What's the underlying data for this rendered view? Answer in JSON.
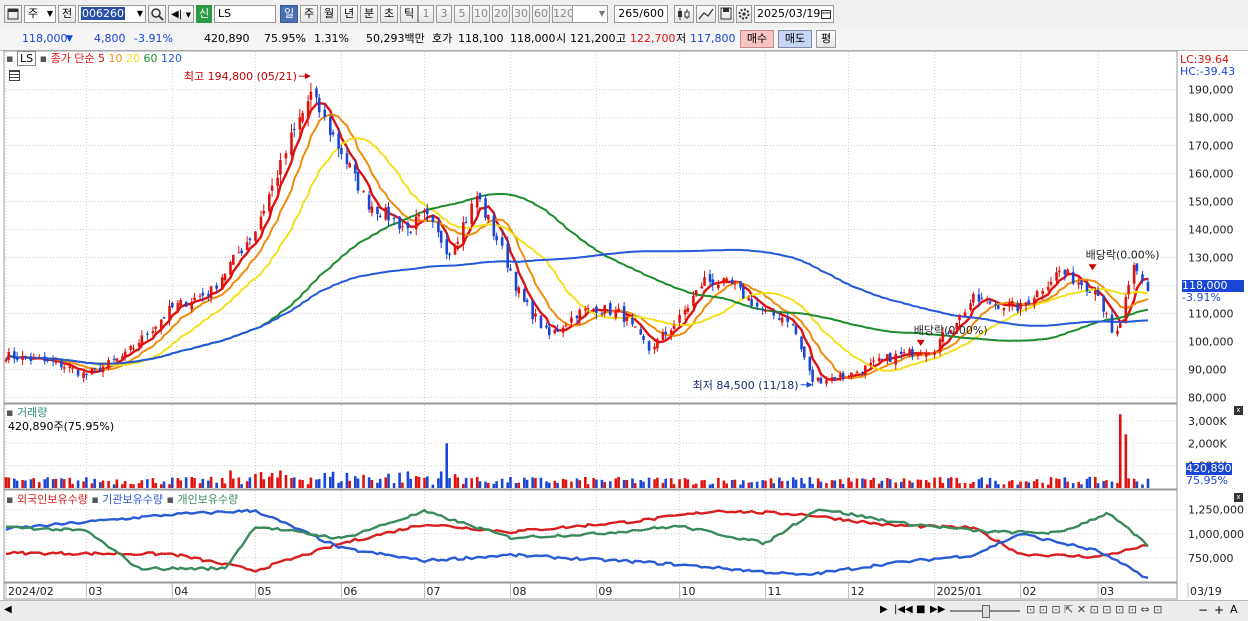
{
  "toolbar": {
    "period_day": "주",
    "prev_label": "전",
    "stock_code": "006260",
    "chip_new": "신",
    "stock_name": "LS",
    "periods": [
      "일",
      "주",
      "월",
      "년",
      "분",
      "초",
      "틱"
    ],
    "active_period": "일",
    "minute_options": [
      "1",
      "3",
      "5",
      "10",
      "20",
      "30",
      "60",
      "120"
    ],
    "count_value": "265",
    "count_total": "/600",
    "date_value": "2025/03/19"
  },
  "quote": {
    "price": "118,000",
    "change": "4,800",
    "change_pct": "-3.91%",
    "volume": "420,890",
    "volume_ratio": "75.95%",
    "turnover": "1.31%",
    "amount": "50,293백만",
    "bid_label": "호가",
    "bid": "118,100",
    "ask": "118,000",
    "open_label": "시",
    "open": "121,200",
    "high_label": "고",
    "high": "122,700",
    "low_label": "저",
    "low": "117,800",
    "buy_label": "매수",
    "sell_label": "매도",
    "avg_label": "평"
  },
  "price_panel": {
    "ticker": "LS",
    "legend_prefix": "종가 단순",
    "ma_periods": [
      "5",
      "10",
      "20",
      "60",
      "120"
    ],
    "lc_label": "LC:39.64",
    "hc_label": "HC:-39.43",
    "last_price_tag": "118,000",
    "last_change_tag": "-3.91%"
  },
  "volume_panel": {
    "title": "거래량",
    "info": "420,890주(75.95%)",
    "tag_value": "420,890",
    "tag_pct": "75.95%"
  },
  "holding_panel": {
    "legend": [
      "외국인보유수량",
      "기관보유수량",
      "개인보유수량"
    ]
  },
  "x_axis": {
    "labels": [
      "2024/02",
      "03",
      "04",
      "05",
      "06",
      "07",
      "08",
      "09",
      "10",
      "11",
      "12",
      "2025/01",
      "02",
      "03",
      "03/19"
    ]
  },
  "colors": {
    "up": "#e1120e",
    "down": "#1a46d6",
    "ma5": "#dd1111",
    "ma10": "#f08c0a",
    "ma20": "#f2e020",
    "ma60": "#1d8c2c",
    "ma120": "#2458d8",
    "foreign": "#d81e1e",
    "institution": "#2a5ad6",
    "individual": "#3a8a5c"
  },
  "chart_data": [
    {
      "type": "candlestick",
      "title": "LS",
      "y_ticks": [
        "80,000",
        "90,000",
        "100,000",
        "110,000",
        "120,000",
        "130,000",
        "140,000",
        "150,000",
        "160,000",
        "170,000",
        "180,000",
        "190,000"
      ],
      "ylim": [
        78000,
        197000
      ],
      "annotations": [
        {
          "text": "최고 194,800 (05/21)",
          "date": "2024/05/21",
          "value": 194800
        },
        {
          "text": "최저 84,500 (11/18)",
          "date": "2024/11/18",
          "value": 84500
        },
        {
          "text": "배당락(0.00%)",
          "date": "2024/12/27",
          "value": 97000
        },
        {
          "text": "배당락(0.00%)",
          "date": "2025/02/27",
          "value": 124000
        }
      ],
      "close_path": [
        {
          "x": "2024/02/01",
          "close": 95000
        },
        {
          "x": "2024/02/20",
          "close": 92000
        },
        {
          "x": "2024/03/01",
          "close": 88000
        },
        {
          "x": "2024/03/15",
          "close": 95000
        },
        {
          "x": "2024/04/01",
          "close": 112000
        },
        {
          "x": "2024/04/15",
          "close": 118000
        },
        {
          "x": "2024/05/01",
          "close": 140000
        },
        {
          "x": "2024/05/15",
          "close": 175000
        },
        {
          "x": "2024/05/21",
          "close": 188000
        },
        {
          "x": "2024/06/01",
          "close": 168000
        },
        {
          "x": "2024/06/10",
          "close": 150000
        },
        {
          "x": "2024/06/25",
          "close": 140000
        },
        {
          "x": "2024/07/01",
          "close": 145000
        },
        {
          "x": "2024/07/10",
          "close": 132000
        },
        {
          "x": "2024/07/20",
          "close": 152000
        },
        {
          "x": "2024/07/31",
          "close": 128000
        },
        {
          "x": "2024/08/05",
          "close": 115000
        },
        {
          "x": "2024/08/15",
          "close": 102000
        },
        {
          "x": "2024/08/25",
          "close": 110000
        },
        {
          "x": "2024/09/01",
          "close": 112000
        },
        {
          "x": "2024/09/10",
          "close": 110000
        },
        {
          "x": "2024/09/20",
          "close": 97000
        },
        {
          "x": "2024/10/01",
          "close": 108000
        },
        {
          "x": "2024/10/10",
          "close": 122000
        },
        {
          "x": "2024/10/20",
          "close": 120000
        },
        {
          "x": "2024/11/01",
          "close": 110000
        },
        {
          "x": "2024/11/10",
          "close": 108000
        },
        {
          "x": "2024/11/18",
          "close": 86000
        },
        {
          "x": "2024/12/01",
          "close": 88000
        },
        {
          "x": "2024/12/15",
          "close": 94000
        },
        {
          "x": "2025/01/01",
          "close": 98000
        },
        {
          "x": "2025/01/15",
          "close": 115000
        },
        {
          "x": "2025/02/01",
          "close": 112000
        },
        {
          "x": "2025/02/15",
          "close": 125000
        },
        {
          "x": "2025/03/01",
          "close": 118000
        },
        {
          "x": "2025/03/07",
          "close": 99000
        },
        {
          "x": "2025/03/14",
          "close": 126000
        },
        {
          "x": "2025/03/19",
          "close": 118000
        }
      ],
      "moving_averages": [
        {
          "name": "5",
          "color": "#dd1111"
        },
        {
          "name": "10",
          "color": "#f08c0a"
        },
        {
          "name": "20",
          "color": "#f2e020"
        },
        {
          "name": "60",
          "color": "#1d8c2c"
        },
        {
          "name": "120",
          "color": "#2458d8"
        }
      ]
    },
    {
      "type": "bar",
      "title": "거래량",
      "y_ticks": [
        "1,000K",
        "2,000K",
        "3,000K"
      ],
      "ylim": [
        0,
        3400000
      ],
      "spikes": [
        {
          "x": "2024/07/10",
          "value": 2000000
        },
        {
          "x": "2025/03/11",
          "value": 3300000
        },
        {
          "x": "2025/03/12",
          "value": 2400000
        }
      ],
      "last_value": 420890
    },
    {
      "type": "line",
      "title": "보유수량",
      "y_ticks": [
        "750,000",
        "1,000,000",
        "1,250,000"
      ],
      "ylim": [
        500000,
        1350000
      ],
      "series": [
        {
          "name": "외국인보유수량",
          "points": [
            {
              "x": "2024/02/01",
              "y": 800000
            },
            {
              "x": "2024/04/01",
              "y": 790000
            },
            {
              "x": "2024/05/01",
              "y": 620000
            },
            {
              "x": "2024/06/01",
              "y": 900000
            },
            {
              "x": "2024/07/01",
              "y": 1100000
            },
            {
              "x": "2024/08/01",
              "y": 1020000
            },
            {
              "x": "2024/09/15",
              "y": 1130000
            },
            {
              "x": "2024/10/15",
              "y": 1240000
            },
            {
              "x": "2024/11/15",
              "y": 1200000
            },
            {
              "x": "2024/12/15",
              "y": 1090000
            },
            {
              "x": "2025/01/15",
              "y": 1060000
            },
            {
              "x": "2025/02/01",
              "y": 790000
            },
            {
              "x": "2025/03/01",
              "y": 760000
            },
            {
              "x": "2025/03/19",
              "y": 880000
            }
          ]
        },
        {
          "name": "기관보유수량",
          "points": [
            {
              "x": "2024/02/01",
              "y": 1050000
            },
            {
              "x": "2024/04/01",
              "y": 1200000
            },
            {
              "x": "2024/05/01",
              "y": 1240000
            },
            {
              "x": "2024/06/01",
              "y": 850000
            },
            {
              "x": "2024/07/01",
              "y": 720000
            },
            {
              "x": "2024/08/01",
              "y": 780000
            },
            {
              "x": "2024/09/15",
              "y": 710000
            },
            {
              "x": "2024/10/01",
              "y": 680000
            },
            {
              "x": "2024/11/15",
              "y": 570000
            },
            {
              "x": "2024/12/15",
              "y": 690000
            },
            {
              "x": "2025/01/15",
              "y": 780000
            },
            {
              "x": "2025/02/01",
              "y": 1000000
            },
            {
              "x": "2025/03/01",
              "y": 820000
            },
            {
              "x": "2025/03/19",
              "y": 540000
            }
          ]
        },
        {
          "name": "개인보유수량",
          "points": [
            {
              "x": "2024/02/01",
              "y": 1070000
            },
            {
              "x": "2024/03/01",
              "y": 1030000
            },
            {
              "x": "2024/03/20",
              "y": 640000
            },
            {
              "x": "2024/04/20",
              "y": 640000
            },
            {
              "x": "2024/05/01",
              "y": 1080000
            },
            {
              "x": "2024/06/01",
              "y": 950000
            },
            {
              "x": "2024/07/01",
              "y": 1230000
            },
            {
              "x": "2024/08/01",
              "y": 960000
            },
            {
              "x": "2024/09/01",
              "y": 1000000
            },
            {
              "x": "2024/10/01",
              "y": 1080000
            },
            {
              "x": "2024/11/01",
              "y": 900000
            },
            {
              "x": "2024/11/20",
              "y": 1260000
            },
            {
              "x": "2024/12/20",
              "y": 1110000
            },
            {
              "x": "2025/01/20",
              "y": 1020000
            },
            {
              "x": "2025/02/15",
              "y": 1010000
            },
            {
              "x": "2025/03/05",
              "y": 1220000
            },
            {
              "x": "2025/03/19",
              "y": 870000
            }
          ]
        }
      ]
    }
  ]
}
